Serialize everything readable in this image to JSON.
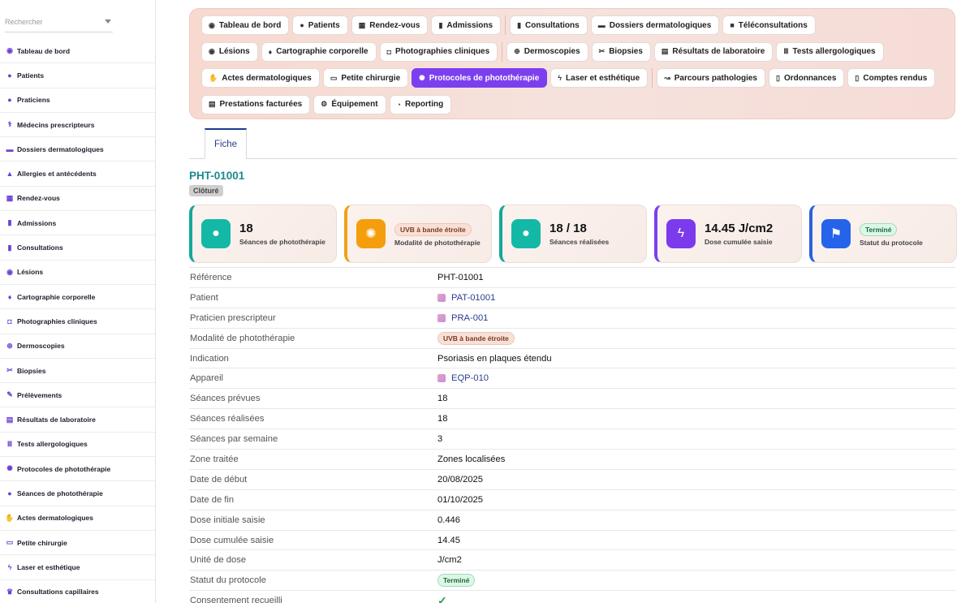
{
  "sidebar": {
    "search_placeholder": "Rechercher",
    "items": [
      {
        "label": "Tableau de bord",
        "icon": "dashboard-icon",
        "glyph": "◉"
      },
      {
        "label": "Patients",
        "icon": "user-icon",
        "glyph": "●"
      },
      {
        "label": "Praticiens",
        "icon": "user-icon",
        "glyph": "●"
      },
      {
        "label": "Médecins prescripteurs",
        "icon": "stethoscope-icon",
        "glyph": "⚕"
      },
      {
        "label": "Dossiers dermatologiques",
        "icon": "folder-icon",
        "glyph": "▬"
      },
      {
        "label": "Allergies et antécédents",
        "icon": "warning-icon",
        "glyph": "▲"
      },
      {
        "label": "Rendez-vous",
        "icon": "calendar-icon",
        "glyph": "▦"
      },
      {
        "label": "Admissions",
        "icon": "clipboard-icon",
        "glyph": "▮"
      },
      {
        "label": "Consultations",
        "icon": "clipboard-icon",
        "glyph": "▮"
      },
      {
        "label": "Lésions",
        "icon": "circle-dot-icon",
        "glyph": "◉"
      },
      {
        "label": "Cartographie corporelle",
        "icon": "body-icon",
        "glyph": "♦"
      },
      {
        "label": "Photographies cliniques",
        "icon": "camera-icon",
        "glyph": "◘"
      },
      {
        "label": "Dermoscopies",
        "icon": "magnifier-icon",
        "glyph": "⊕"
      },
      {
        "label": "Biopsies",
        "icon": "scissors-icon",
        "glyph": "✂"
      },
      {
        "label": "Prélèvements",
        "icon": "syringe-icon",
        "glyph": "✎"
      },
      {
        "label": "Résultats de laboratoire",
        "icon": "report-icon",
        "glyph": "▤"
      },
      {
        "label": "Tests allergologiques",
        "icon": "test-tubes-icon",
        "glyph": "Ⅲ"
      },
      {
        "label": "Protocoles de photothérapie",
        "icon": "sun-icon",
        "glyph": "✺"
      },
      {
        "label": "Séances de photothérapie",
        "icon": "lightbulb-icon",
        "glyph": "●"
      },
      {
        "label": "Actes dermatologiques",
        "icon": "hand-medical-icon",
        "glyph": "✋"
      },
      {
        "label": "Petite chirurgie",
        "icon": "bed-icon",
        "glyph": "▭"
      },
      {
        "label": "Laser et esthétique",
        "icon": "bolt-icon",
        "glyph": "ϟ"
      },
      {
        "label": "Consultations capillaires",
        "icon": "crown-icon",
        "glyph": "♛"
      }
    ]
  },
  "toolbar": {
    "rows": [
      [
        [
          {
            "label": "Tableau de bord",
            "icon": "dashboard-icon",
            "glyph": "◉"
          },
          {
            "label": "Patients",
            "icon": "user-icon",
            "glyph": "●"
          },
          {
            "label": "Rendez-vous",
            "icon": "calendar-icon",
            "glyph": "▦"
          },
          {
            "label": "Admissions",
            "icon": "clipboard-icon",
            "glyph": "▮"
          }
        ],
        [
          {
            "label": "Consultations",
            "icon": "clipboard-icon",
            "glyph": "▮"
          },
          {
            "label": "Dossiers dermatologiques",
            "icon": "folder-icon",
            "glyph": "▬"
          },
          {
            "label": "Téléconsultations",
            "icon": "video-icon",
            "glyph": "■"
          }
        ]
      ],
      [
        [
          {
            "label": "Lésions",
            "icon": "circle-dot-icon",
            "glyph": "◉"
          },
          {
            "label": "Cartographie corporelle",
            "icon": "body-icon",
            "glyph": "♦"
          },
          {
            "label": "Photographies cliniques",
            "icon": "camera-icon",
            "glyph": "◘"
          }
        ],
        [
          {
            "label": "Dermoscopies",
            "icon": "magnifier-icon",
            "glyph": "⊕"
          },
          {
            "label": "Biopsies",
            "icon": "scissors-icon",
            "glyph": "✂"
          },
          {
            "label": "Résultats de laboratoire",
            "icon": "report-icon",
            "glyph": "▤"
          },
          {
            "label": "Tests allergologiques",
            "icon": "test-tubes-icon",
            "glyph": "Ⅲ"
          }
        ]
      ],
      [
        [
          {
            "label": "Actes dermatologiques",
            "icon": "hand-medical-icon",
            "glyph": "✋"
          },
          {
            "label": "Petite chirurgie",
            "icon": "bed-icon",
            "glyph": "▭"
          },
          {
            "label": "Protocoles de photothérapie",
            "icon": "sun-icon",
            "glyph": "✺",
            "active": true
          },
          {
            "label": "Laser et esthétique",
            "icon": "bolt-icon",
            "glyph": "ϟ"
          }
        ],
        [
          {
            "label": "Parcours pathologies",
            "icon": "route-icon",
            "glyph": "↝"
          },
          {
            "label": "Ordonnances",
            "icon": "prescription-icon",
            "glyph": "▯"
          },
          {
            "label": "Comptes rendus",
            "icon": "document-icon",
            "glyph": "▯"
          }
        ]
      ],
      [
        [
          {
            "label": "Prestations facturées",
            "icon": "invoice-icon",
            "glyph": "▤"
          },
          {
            "label": "Équipement",
            "icon": "equipment-icon",
            "glyph": "⚙"
          },
          {
            "label": "Reporting",
            "icon": "pie-chart-icon",
            "glyph": "◔"
          }
        ]
      ]
    ]
  },
  "tabs": {
    "fiche": "Fiche"
  },
  "record": {
    "title": "PHT-01001",
    "status_badge": "Clôturé"
  },
  "cards": [
    {
      "value": "18",
      "label": "Séances de photothérapie",
      "icon": "lightbulb-icon",
      "glyph": "●",
      "color": "#14b8a6",
      "accent": "#14a79a"
    },
    {
      "chip": "UVB à bande étroite",
      "label": "Modalité de photothérapie",
      "icon": "sun-icon",
      "glyph": "✺",
      "color": "#f59e0b",
      "accent": "#f0a11a"
    },
    {
      "value": "18 / 18",
      "label": "Séances réalisées",
      "icon": "lightbulb-icon",
      "glyph": "●",
      "color": "#14b8a6",
      "accent": "#14a79a"
    },
    {
      "value": "14.45 J/cm2",
      "label": "Dose cumulée saisie",
      "icon": "bolt-icon",
      "glyph": "ϟ",
      "color": "#7c3aed",
      "accent": "#7b3ff0"
    },
    {
      "chip_green": "Terminé",
      "label": "Statut du protocole",
      "icon": "flag-icon",
      "glyph": "⚑",
      "color": "#2563eb",
      "accent": "#2f5fe0"
    }
  ],
  "details": [
    {
      "label": "Référence",
      "value": "PHT-01001"
    },
    {
      "label": "Patient",
      "link": "PAT-01001"
    },
    {
      "label": "Praticien prescripteur",
      "link": "PRA-001"
    },
    {
      "label": "Modalité de photothérapie",
      "chip": "UVB à bande étroite"
    },
    {
      "label": "Indication",
      "value": "Psoriasis en plaques étendu"
    },
    {
      "label": "Appareil",
      "link": "EQP-010"
    },
    {
      "label": "Séances prévues",
      "value": "18"
    },
    {
      "label": "Séances réalisées",
      "value": "18"
    },
    {
      "label": "Séances par semaine",
      "value": "3"
    },
    {
      "label": "Zone traitée",
      "value": "Zones localisées"
    },
    {
      "label": "Date de début",
      "value": "20/08/2025"
    },
    {
      "label": "Date de fin",
      "value": "01/10/2025"
    },
    {
      "label": "Dose initiale saisie",
      "value": "0.446"
    },
    {
      "label": "Dose cumulée saisie",
      "value": "14.45"
    },
    {
      "label": "Unité de dose",
      "value": "J/cm2"
    },
    {
      "label": "Statut du protocole",
      "chip_green": "Terminé"
    },
    {
      "label": "Consentement recueilli",
      "check": true
    }
  ]
}
